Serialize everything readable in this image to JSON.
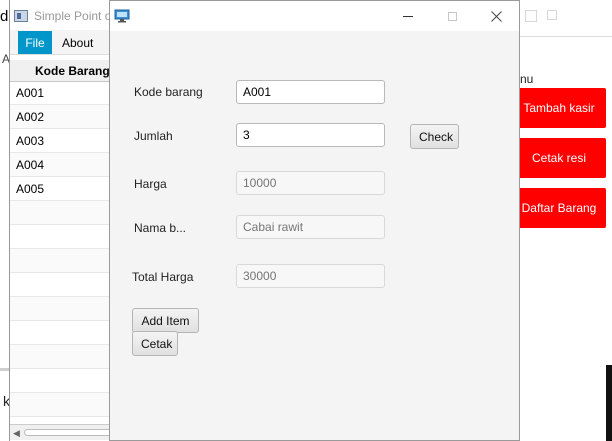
{
  "back_window": {
    "title_fragment": "d",
    "left_fragment": "A",
    "left_bottom_text": "k",
    "menu_label": "nu",
    "buttons": [
      "Tambah kasir",
      "Cetak resi",
      "Daftar Barang"
    ],
    "button_color": "#ff0000"
  },
  "main_window": {
    "title": "Simple Point of Sale",
    "menu": {
      "file": "File",
      "about": "About"
    },
    "menu_active_color": "#0096c9",
    "table": {
      "header": "Kode Barang",
      "rows": [
        "A001",
        "A002",
        "A003",
        "A004",
        "A005"
      ]
    }
  },
  "dialog": {
    "fields": {
      "kode_barang": {
        "label": "Kode barang",
        "value": "A001"
      },
      "jumlah": {
        "label": "Jumlah",
        "value": "3"
      },
      "harga": {
        "label": "Harga",
        "placeholder": "10000"
      },
      "nama_barang": {
        "label": "Nama b...",
        "placeholder": "Cabai rawit"
      },
      "total_harga": {
        "label": "Total Harga",
        "placeholder": "30000"
      }
    },
    "buttons": {
      "check": "Check",
      "add_item": "Add Item",
      "cetak": "Cetak"
    }
  }
}
